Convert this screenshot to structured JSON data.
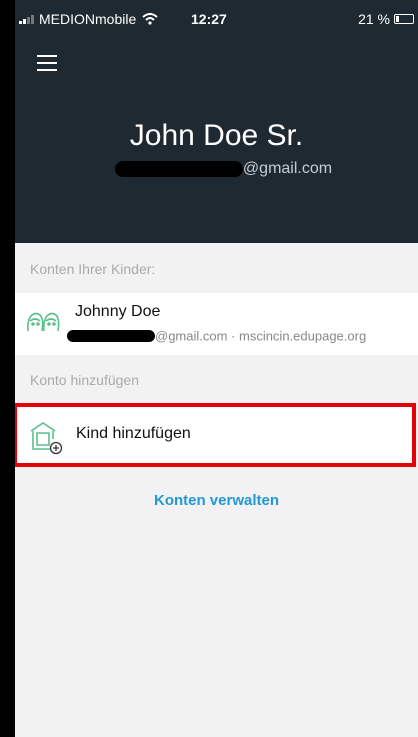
{
  "status_bar": {
    "carrier": "MEDIONmobile",
    "time": "12:27",
    "battery_text": "21 %",
    "battery_level": 0.21
  },
  "header": {
    "menu_icon": "menu-icon",
    "user_name": "John Doe Sr.",
    "user_email_domain": "@gmail.com"
  },
  "children_section": {
    "label": "Konten Ihrer Kinder:",
    "items": [
      {
        "name": "Johnny Doe",
        "meta": "@gmail.com · mscincin.edupage.org",
        "icon": "children-icon"
      }
    ]
  },
  "add_section": {
    "label": "Konto hinzufügen",
    "add_child_label": "Kind hinzufügen",
    "icon": "add-child-icon"
  },
  "manage_accounts_label": "Konten verwalten",
  "colors": {
    "header_bg": "#1f2931",
    "accent": "#2298d6",
    "icon_green": "#5bbf8a",
    "highlight": "#e5000a",
    "page_bg": "#f2f2f2"
  }
}
